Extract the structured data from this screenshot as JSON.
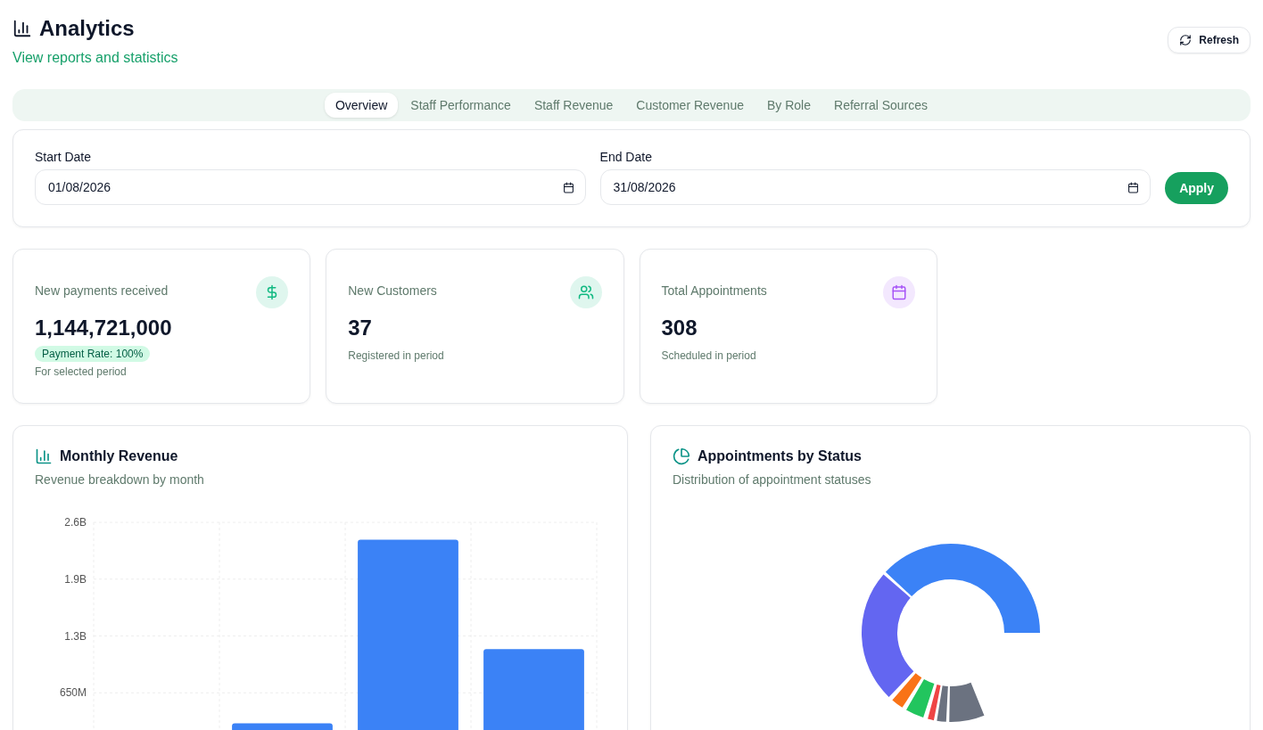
{
  "header": {
    "title": "Analytics",
    "subtitle": "View reports and statistics",
    "refresh_button": "Refresh"
  },
  "tabs": [
    {
      "label": "Overview",
      "selected": true
    },
    {
      "label": "Staff Performance",
      "selected": false
    },
    {
      "label": "Staff Revenue",
      "selected": false
    },
    {
      "label": "Customer Revenue",
      "selected": false
    },
    {
      "label": "By Role",
      "selected": false
    },
    {
      "label": "Referral Sources",
      "selected": false
    }
  ],
  "date_filter": {
    "start": {
      "label": "Start Date",
      "value": "01/08/2026"
    },
    "end": {
      "label": "End Date",
      "value": "31/08/2026"
    },
    "apply_button": "Apply"
  },
  "stats": [
    {
      "kind": "money",
      "label": "New payments received",
      "value": "1,144,721,000",
      "badge": "Payment Rate: 100%",
      "note": "For selected period",
      "color": "#10b981"
    },
    {
      "kind": "users",
      "label": "New Customers",
      "value": "37",
      "note": "Registered in period",
      "color": "#10b981"
    },
    {
      "kind": "calendar",
      "label": "Total Appointments",
      "value": "308",
      "note": "Scheduled in period",
      "color": "#a855f7"
    }
  ],
  "revenue_chart": {
    "title": "Monthly Revenue",
    "subtitle": "Revenue breakdown by month",
    "chart_data": {
      "type": "bar",
      "ylim": [
        0,
        2600000000
      ],
      "yticks": [
        {
          "value": 650000000,
          "label": "650M"
        },
        {
          "value": 1300000000,
          "label": "1.3B"
        },
        {
          "value": 1950000000,
          "label": "1.9B"
        },
        {
          "value": 2600000000,
          "label": "2.6B"
        }
      ],
      "grid": true,
      "values": [
        0,
        300000000,
        2400000000,
        1150000000
      ]
    }
  },
  "status_chart": {
    "title": "Appointments by Status",
    "subtitle": "Distribution of appointment statuses"
  }
}
